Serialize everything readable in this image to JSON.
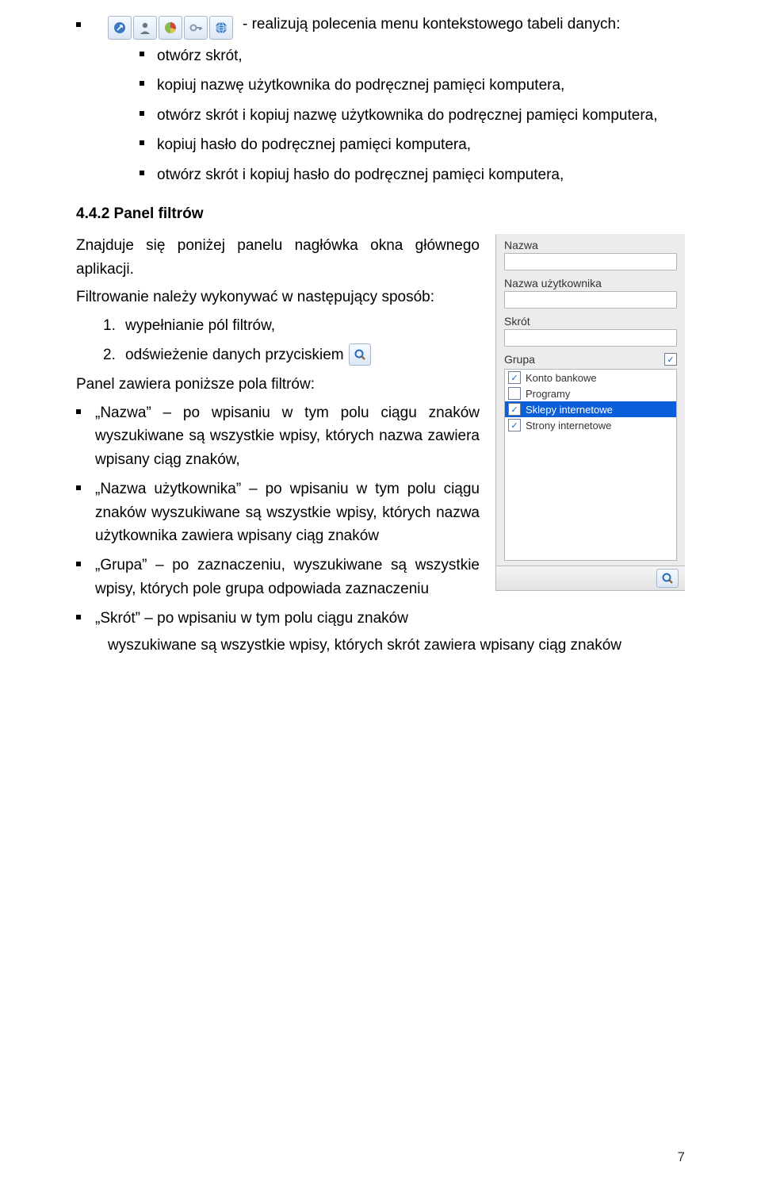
{
  "toolbar_icons": [
    "shortcut-icon",
    "user-icon",
    "piechart-icon",
    "key-icon",
    "globe-icon"
  ],
  "intro_line": "- realizują polecenia menu kontekstowego tabeli danych:",
  "context_menu_items": [
    "otwórz skrót,",
    "kopiuj nazwę użytkownika do podręcznej pamięci komputera,",
    "otwórz skrót i kopiuj nazwę użytkownika do podręcznej pamięci komputera,",
    "kopiuj hasło do podręcznej pamięci komputera,",
    "otwórz skrót i kopiuj hasło do podręcznej pamięci komputera,"
  ],
  "section_heading": "4.4.2 Panel filtrów",
  "para1": "Znajduje się poniżej panelu nagłówka okna głównego aplikacji.",
  "para2": "Filtrowanie należy wykonywać w następujący sposób:",
  "steps": [
    "wypełnianie pól filtrów,",
    "odświeżenie danych przyciskiem"
  ],
  "para3": "Panel zawiera poniższe pola filtrów:",
  "filter_bullets": [
    "„Nazwa” – po wpisaniu w tym polu ciągu znaków wyszukiwane są wszystkie wpisy, których nazwa zawiera wpisany ciąg znaków,",
    "„Nazwa użytkownika” – po wpisaniu w tym polu ciągu znaków wyszukiwane są wszystkie wpisy, których nazwa użytkownika zawiera wpisany ciąg znaków",
    "„Grupa” – po zaznaczeniu, wyszukiwane są wszystkie wpisy, których pole grupa odpowiada zaznaczeniu",
    "„Skrót” – po wpisaniu w tym polu ciągu znaków"
  ],
  "last_line": "wyszukiwane są wszystkie wpisy, których skrót zawiera wpisany ciąg znaków",
  "panel": {
    "labels": {
      "nazwa": "Nazwa",
      "nazwa_uzytkownika": "Nazwa użytkownika",
      "skrot": "Skrót",
      "grupa": "Grupa"
    },
    "values": {
      "nazwa": "",
      "nazwa_uzytkownika": "",
      "skrot": ""
    },
    "group_master_checked": true,
    "groups": [
      {
        "label": "Konto bankowe",
        "checked": true,
        "selected": false
      },
      {
        "label": "Programy",
        "checked": false,
        "selected": false
      },
      {
        "label": "Sklepy internetowe",
        "checked": true,
        "selected": true
      },
      {
        "label": "Strony internetowe",
        "checked": true,
        "selected": false
      }
    ]
  },
  "page_number": "7"
}
